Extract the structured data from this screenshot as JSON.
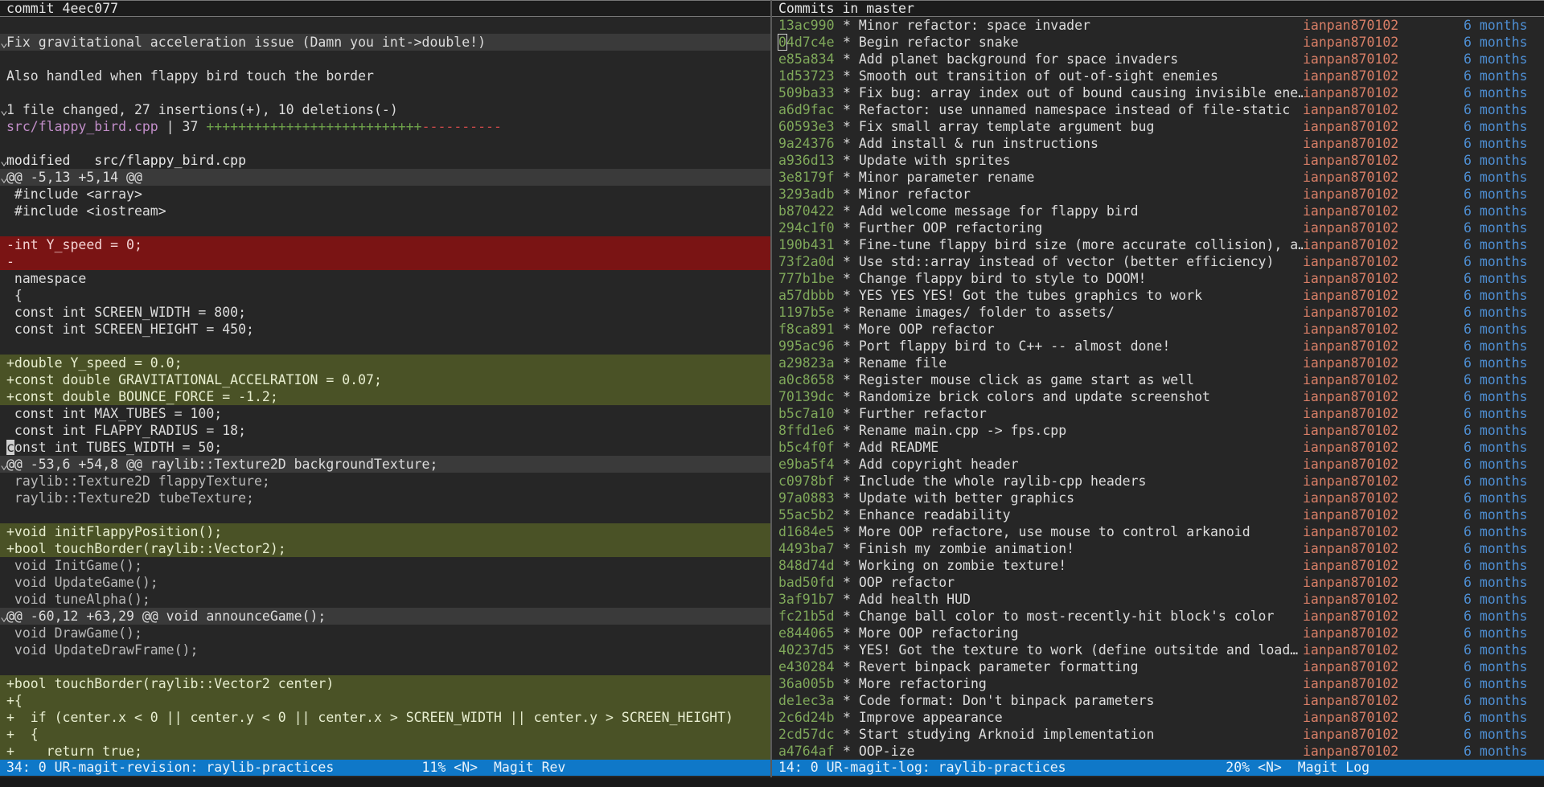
{
  "left": {
    "header": "commit 4eec077",
    "commit_message": "Fix gravitational acceleration issue (Damn you int->double!)",
    "commit_body": "Also handled when flappy bird touch the border",
    "summary": "1 file changed, 27 insertions(+), 10 deletions(-)",
    "stat_file": "src/flappy_bird.cpp",
    "stat_count": " | 37 ",
    "stat_plus": "+++++++++++++++++++++++++++",
    "stat_minus": "----------",
    "modified_label": "modified   src/flappy_bird.cpp",
    "diff": [
      {
        "type": "hunk",
        "text": "@@ -5,13 +5,14 @@"
      },
      {
        "type": "ctx",
        "text": " #include <array>"
      },
      {
        "type": "ctx",
        "text": " #include <iostream>"
      },
      {
        "type": "ctx",
        "text": ""
      },
      {
        "type": "del",
        "text": "-int Y_speed = 0;"
      },
      {
        "type": "del",
        "text": "-"
      },
      {
        "type": "ctx",
        "text": " namespace"
      },
      {
        "type": "ctx",
        "text": " {"
      },
      {
        "type": "ctx",
        "text": " const int SCREEN_WIDTH = 800;"
      },
      {
        "type": "ctx",
        "text": " const int SCREEN_HEIGHT = 450;"
      },
      {
        "type": "ctx",
        "text": ""
      },
      {
        "type": "add",
        "text": "+double Y_speed = 0.0;"
      },
      {
        "type": "add",
        "text": "+const double GRAVITATIONAL_ACCELRATION = 0.07;"
      },
      {
        "type": "add",
        "text": "+const double BOUNCE_FORCE = -1.2;"
      },
      {
        "type": "ctx",
        "text": " const int MAX_TUBES = 100;"
      },
      {
        "type": "ctx",
        "text": " const int FLAPPY_RADIUS = 18;"
      },
      {
        "type": "cursor",
        "text": "const int TUBES_WIDTH = 50;"
      },
      {
        "type": "hunk",
        "text": "@@ -53,6 +54,8 @@ raylib::Texture2D backgroundTexture;"
      },
      {
        "type": "dim",
        "text": " raylib::Texture2D flappyTexture;"
      },
      {
        "type": "dim",
        "text": " raylib::Texture2D tubeTexture;"
      },
      {
        "type": "ctx",
        "text": ""
      },
      {
        "type": "add",
        "text": "+void initFlappyPosition();"
      },
      {
        "type": "add",
        "text": "+bool touchBorder(raylib::Vector2);"
      },
      {
        "type": "dim",
        "text": " void InitGame();"
      },
      {
        "type": "dim",
        "text": " void UpdateGame();"
      },
      {
        "type": "dim",
        "text": " void tuneAlpha();"
      },
      {
        "type": "hunk",
        "text": "@@ -60,12 +63,29 @@ void announceGame();"
      },
      {
        "type": "dim",
        "text": " void DrawGame();"
      },
      {
        "type": "dim",
        "text": " void UpdateDrawFrame();"
      },
      {
        "type": "ctx",
        "text": ""
      },
      {
        "type": "add",
        "text": "+bool touchBorder(raylib::Vector2 center)"
      },
      {
        "type": "add",
        "text": "+{"
      },
      {
        "type": "add",
        "text": "+  if (center.x < 0 || center.y < 0 || center.x > SCREEN_WIDTH || center.y > SCREEN_HEIGHT)"
      },
      {
        "type": "add",
        "text": "+  {"
      },
      {
        "type": "add",
        "text": "+    return true;"
      }
    ],
    "modeline": "34: 0 UR-magit-revision: raylib-practices           11% <N>  Magit Rev"
  },
  "right": {
    "header": "Commits in master",
    "commits": [
      {
        "hash": "13ac990",
        "msg": "* Minor refactor: space invader",
        "author": "ianpan870102",
        "date": "6 months"
      },
      {
        "hash": "04d7c4e",
        "msg": "* Begin refactor snake",
        "author": "ianpan870102",
        "date": "6 months"
      },
      {
        "hash": "e85a834",
        "msg": "* Add planet background for space invaders",
        "author": "ianpan870102",
        "date": "6 months"
      },
      {
        "hash": "1d53723",
        "msg": "* Smooth out transition of out-of-sight enemies",
        "author": "ianpan870102",
        "date": "6 months"
      },
      {
        "hash": "509ba33",
        "msg": "* Fix bug: array index out of bound causing invisible ene…",
        "author": "ianpan870102",
        "date": "6 months"
      },
      {
        "hash": "a6d9fac",
        "msg": "* Refactor: use unnamed namespace instead of file-static",
        "author": "ianpan870102",
        "date": "6 months"
      },
      {
        "hash": "60593e3",
        "msg": "* Fix small array template argument bug",
        "author": "ianpan870102",
        "date": "6 months"
      },
      {
        "hash": "9a24376",
        "msg": "* Add install & run instructions",
        "author": "ianpan870102",
        "date": "6 months"
      },
      {
        "hash": "a936d13",
        "msg": "* Update with sprites",
        "author": "ianpan870102",
        "date": "6 months"
      },
      {
        "hash": "3e8179f",
        "msg": "* Minor parameter rename",
        "author": "ianpan870102",
        "date": "6 months"
      },
      {
        "hash": "3293adb",
        "msg": "* Minor refactor",
        "author": "ianpan870102",
        "date": "6 months"
      },
      {
        "hash": "b870422",
        "msg": "* Add welcome message for flappy bird",
        "author": "ianpan870102",
        "date": "6 months"
      },
      {
        "hash": "294c1f0",
        "msg": "* Further OOP refactoring",
        "author": "ianpan870102",
        "date": "6 months"
      },
      {
        "hash": "190b431",
        "msg": "* Fine-tune flappy bird size (more accurate collision), a…",
        "author": "ianpan870102",
        "date": "6 months"
      },
      {
        "hash": "73f2a0d",
        "msg": "* Use std::array instead of vector (better efficiency)",
        "author": "ianpan870102",
        "date": "6 months"
      },
      {
        "hash": "777b1be",
        "msg": "* Change flappy bird to style to DOOM!",
        "author": "ianpan870102",
        "date": "6 months"
      },
      {
        "hash": "a57dbbb",
        "msg": "* YES YES YES! Got the tubes graphics to work",
        "author": "ianpan870102",
        "date": "6 months"
      },
      {
        "hash": "1197b5e",
        "msg": "* Rename images/ folder to assets/",
        "author": "ianpan870102",
        "date": "6 months"
      },
      {
        "hash": "f8ca891",
        "msg": "* More OOP refactor",
        "author": "ianpan870102",
        "date": "6 months"
      },
      {
        "hash": "995ac96",
        "msg": "* Port flappy bird to C++ -- almost done!",
        "author": "ianpan870102",
        "date": "6 months"
      },
      {
        "hash": "a29823a",
        "msg": "* Rename file",
        "author": "ianpan870102",
        "date": "6 months"
      },
      {
        "hash": "a0c8658",
        "msg": "* Register mouse click as game start as well",
        "author": "ianpan870102",
        "date": "6 months"
      },
      {
        "hash": "70139dc",
        "msg": "* Randomize brick colors and update screenshot",
        "author": "ianpan870102",
        "date": "6 months"
      },
      {
        "hash": "b5c7a10",
        "msg": "* Further refactor",
        "author": "ianpan870102",
        "date": "6 months"
      },
      {
        "hash": "8ffd1e6",
        "msg": "* Rename main.cpp -> fps.cpp",
        "author": "ianpan870102",
        "date": "6 months"
      },
      {
        "hash": "b5c4f0f",
        "msg": "* Add README",
        "author": "ianpan870102",
        "date": "6 months"
      },
      {
        "hash": "e9ba5f4",
        "msg": "* Add copyright header",
        "author": "ianpan870102",
        "date": "6 months"
      },
      {
        "hash": "c0978bf",
        "msg": "* Include the whole raylib-cpp headers",
        "author": "ianpan870102",
        "date": "6 months"
      },
      {
        "hash": "97a0883",
        "msg": "* Update with better graphics",
        "author": "ianpan870102",
        "date": "6 months"
      },
      {
        "hash": "55ac5b2",
        "msg": "* Enhance readability",
        "author": "ianpan870102",
        "date": "6 months"
      },
      {
        "hash": "d1684e5",
        "msg": "* More OOP refactore, use mouse to control arkanoid",
        "author": "ianpan870102",
        "date": "6 months"
      },
      {
        "hash": "4493ba7",
        "msg": "* Finish my zombie animation!",
        "author": "ianpan870102",
        "date": "6 months"
      },
      {
        "hash": "848d74d",
        "msg": "* Working on zombie texture!",
        "author": "ianpan870102",
        "date": "6 months"
      },
      {
        "hash": "bad50fd",
        "msg": "* OOP refactor",
        "author": "ianpan870102",
        "date": "6 months"
      },
      {
        "hash": "3af91b7",
        "msg": "* Add health HUD",
        "author": "ianpan870102",
        "date": "6 months"
      },
      {
        "hash": "fc21b5d",
        "msg": "* Change ball color to most-recently-hit block's color",
        "author": "ianpan870102",
        "date": "6 months"
      },
      {
        "hash": "e844065",
        "msg": "* More OOP refactoring",
        "author": "ianpan870102",
        "date": "6 months"
      },
      {
        "hash": "40237d5",
        "msg": "* YES! Got the texture to work (define outsitde and load…",
        "author": "ianpan870102",
        "date": "6 months"
      },
      {
        "hash": "e430284",
        "msg": "* Revert binpack parameter formatting",
        "author": "ianpan870102",
        "date": "6 months"
      },
      {
        "hash": "36a005b",
        "msg": "* More refactoring",
        "author": "ianpan870102",
        "date": "6 months"
      },
      {
        "hash": "de1ec3a",
        "msg": "* Code format: Don't binpack parameters",
        "author": "ianpan870102",
        "date": "6 months"
      },
      {
        "hash": "2c6d24b",
        "msg": "* Improve appearance",
        "author": "ianpan870102",
        "date": "6 months"
      },
      {
        "hash": "2cd57dc",
        "msg": "* Start studying Arknoid implementation",
        "author": "ianpan870102",
        "date": "6 months"
      },
      {
        "hash": "a4764af",
        "msg": "* OOP-ize",
        "author": "ianpan870102",
        "date": "6 months"
      }
    ],
    "modeline": "14: 0 UR-magit-log: raylib-practices                    20% <N>  Magit Log"
  },
  "colors": {
    "background": "#262626",
    "modeline": "#0f78c8",
    "added_bg": "#4a5226",
    "removed_bg": "#7a1414",
    "hash": "#7fa85a",
    "author": "#d97f67",
    "date": "#4e8fd4"
  },
  "icons": {
    "fold": "chevron-down-icon"
  }
}
